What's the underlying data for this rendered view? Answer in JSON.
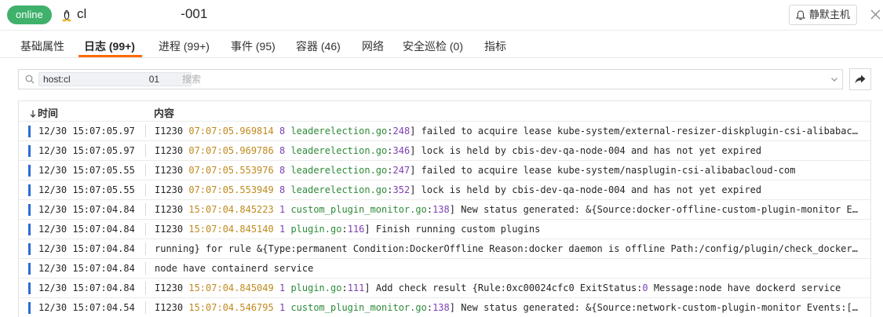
{
  "header": {
    "status": "online",
    "host_prefix": "cl",
    "host_suffix": "-001",
    "silence_label": "静默主机",
    "colors": {
      "status_bg": "#3fb16b",
      "accent": "#ff6a00"
    }
  },
  "tabs": [
    {
      "label": "基础属性",
      "active": false
    },
    {
      "label": "日志 (99+)",
      "active": true
    },
    {
      "label": "进程 (99+)",
      "active": false
    },
    {
      "label": "事件 (95)",
      "active": false
    },
    {
      "label": "容器 (46)",
      "active": false
    },
    {
      "label": "网络",
      "active": false
    },
    {
      "label": "安全巡检 (0)",
      "active": false
    },
    {
      "label": "指标",
      "active": false
    }
  ],
  "search": {
    "filter_prefix": "host:cl",
    "filter_suffix": "01",
    "placeholder": "搜索"
  },
  "table": {
    "columns": {
      "time": "时间",
      "content": "内容"
    },
    "rows": [
      {
        "time": "12/30 15:07:05.97",
        "level": "I1230",
        "ts": "07:07:05.969814",
        "num": "8",
        "file": "leaderelection.go",
        "line": "248",
        "msg": "] failed to acquire lease kube-system/external-resizer-diskplugin-csi-alibabacloud-com"
      },
      {
        "time": "12/30 15:07:05.97",
        "level": "I1230",
        "ts": "07:07:05.969786",
        "num": "8",
        "file": "leaderelection.go",
        "line": "346",
        "msg": "] lock is held by cbis-dev-qa-node-004 and has not yet expired"
      },
      {
        "time": "12/30 15:07:05.55",
        "level": "I1230",
        "ts": "07:07:05.553976",
        "num": "8",
        "file": "leaderelection.go",
        "line": "247",
        "msg": "] failed to acquire lease kube-system/nasplugin-csi-alibabacloud-com"
      },
      {
        "time": "12/30 15:07:05.55",
        "level": "I1230",
        "ts": "07:07:05.553949",
        "num": "8",
        "file": "leaderelection.go",
        "line": "352",
        "msg": "] lock is held by cbis-dev-qa-node-004 and has not yet expired"
      },
      {
        "time": "12/30 15:07:04.84",
        "level": "I1230",
        "ts": "15:07:04.845223",
        "num": "1",
        "file": "custom_plugin_monitor.go",
        "line": "138",
        "msg": "] New status generated: &{Source:docker-offline-custom-plugin-monitor Events:[]}"
      },
      {
        "time": "12/30 15:07:04.84",
        "level": "I1230",
        "ts": "15:07:04.845140",
        "num": "1",
        "file": "plugin.go",
        "line": "116",
        "msg": "] Finish running custom plugins"
      },
      {
        "time": "12/30 15:07:04.84",
        "plain": "running} for rule &{Type:permanent Condition:DockerOffline Reason:docker daemon is offline Path:/config/plugin/check_docker_offline.sh}"
      },
      {
        "time": "12/30 15:07:04.84",
        "plain": "node have containerd service"
      },
      {
        "time": "12/30 15:07:04.84",
        "level": "I1230",
        "ts": "15:07:04.845049",
        "num": "1",
        "file": "plugin.go",
        "line": "111",
        "msg": "] Add check result {Rule:0xc00024cfc0 ExitStatus:",
        "num2": "0",
        "msg2": " Message:node have dockerd service"
      },
      {
        "time": "12/30 15:07:04.54",
        "level": "I1230",
        "ts": "15:07:04.546795",
        "num": "1",
        "file": "custom_plugin_monitor.go",
        "line": "138",
        "msg": "] New status generated: &{Source:network-custom-plugin-monitor Events:[]}"
      }
    ]
  }
}
